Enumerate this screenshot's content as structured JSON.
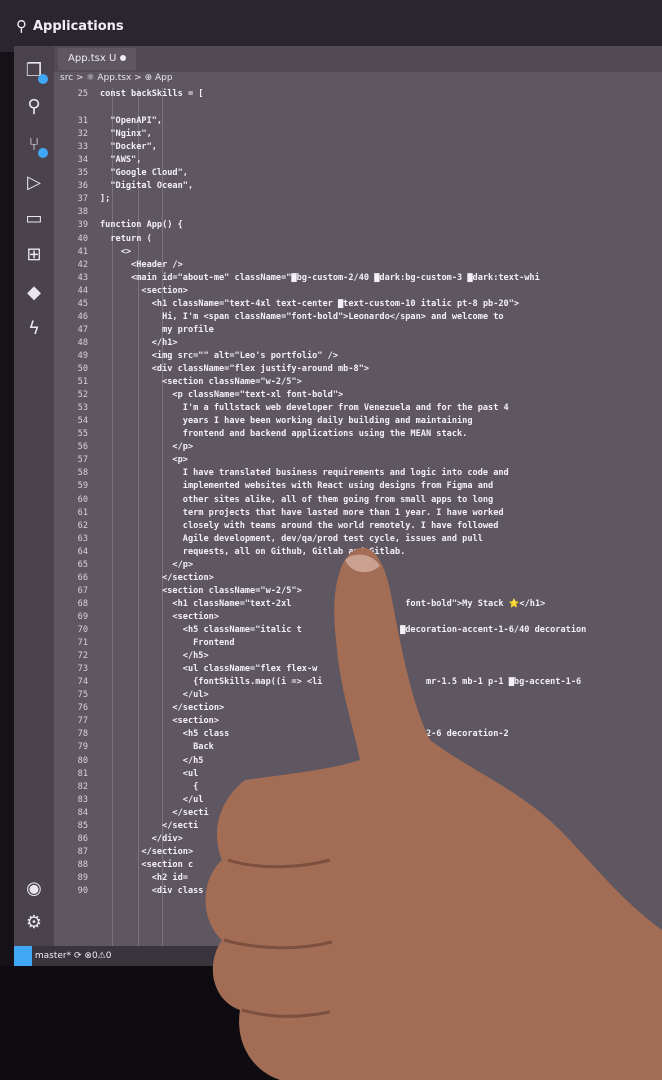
{
  "topbar": {
    "title": "Applications",
    "search_icon": "search-icon"
  },
  "tab": {
    "label": "App.tsx U"
  },
  "breadcrumb": {
    "text": "src > ⚛ App.tsx > ⊕ App"
  },
  "status": {
    "branch": "master*",
    "sync": "⟳",
    "problems": "⊗0⚠0"
  },
  "code": [
    {
      "n": "25",
      "t": "const backSkills = ["
    },
    {
      "n": "31",
      "t": "  \"OpenAPI\","
    },
    {
      "n": "32",
      "t": "  \"Nginx\","
    },
    {
      "n": "33",
      "t": "  \"Docker\","
    },
    {
      "n": "34",
      "t": "  \"AWS\","
    },
    {
      "n": "35",
      "t": "  \"Google Cloud\","
    },
    {
      "n": "36",
      "t": "  \"Digital Ocean\","
    },
    {
      "n": "37",
      "t": "];"
    },
    {
      "n": "38",
      "t": ""
    },
    {
      "n": "39",
      "t": "function App() {"
    },
    {
      "n": "40",
      "t": "  return ("
    },
    {
      "n": "41",
      "t": "    <>"
    },
    {
      "n": "42",
      "t": "      <Header />"
    },
    {
      "n": "43",
      "t": "      <main id=\"about-me\" className=\"▇bg-custom-2/40 ▇dark:bg-custom-3 ▇dark:text-whi"
    },
    {
      "n": "44",
      "t": "        <section>"
    },
    {
      "n": "45",
      "t": "          <h1 className=\"text-4xl text-center ▇text-custom-10 italic pt-8 pb-20\">"
    },
    {
      "n": "46",
      "t": "            Hi, I'm <span className=\"font-bold\">Leonardo</span> and welcome to"
    },
    {
      "n": "47",
      "t": "            my profile"
    },
    {
      "n": "48",
      "t": "          </h1>"
    },
    {
      "n": "49",
      "t": "          <img src=\"\" alt=\"Leo's portfolio\" />"
    },
    {
      "n": "50",
      "t": "          <div className=\"flex justify-around mb-8\">"
    },
    {
      "n": "51",
      "t": "            <section className=\"w-2/5\">"
    },
    {
      "n": "52",
      "t": "              <p className=\"text-xl font-bold\">"
    },
    {
      "n": "53",
      "t": "                I'm a fullstack web developer from Venezuela and for the past 4"
    },
    {
      "n": "54",
      "t": "                years I have been working daily building and maintaining"
    },
    {
      "n": "55",
      "t": "                frontend and backend applications using the MEAN stack."
    },
    {
      "n": "56",
      "t": "              </p>"
    },
    {
      "n": "57",
      "t": "              <p>"
    },
    {
      "n": "58",
      "t": "                I have translated business requirements and logic into code and"
    },
    {
      "n": "59",
      "t": "                implemented websites with React using designs from Figma and"
    },
    {
      "n": "60",
      "t": "                other sites alike, all of them going from small apps to long"
    },
    {
      "n": "61",
      "t": "                term projects that have lasted more than 1 year. I have worked"
    },
    {
      "n": "62",
      "t": "                closely with teams around the world remotely. I have followed"
    },
    {
      "n": "63",
      "t": "                Agile development, dev/qa/prod test cycle, issues and pull"
    },
    {
      "n": "64",
      "t": "                requests, all on Github, Gitlab and Gitlab."
    },
    {
      "n": "65",
      "t": "              </p>"
    },
    {
      "n": "66",
      "t": "            </section>"
    },
    {
      "n": "67",
      "t": "            <section className=\"w-2/5\">"
    },
    {
      "n": "68",
      "t": "              <h1 className=\"text-2xl                      font-bold\">My Stack ⭐</h1>"
    },
    {
      "n": "69",
      "t": "              <section>"
    },
    {
      "n": "70",
      "t": "                <h5 className=\"italic t                   ▇decoration-accent-1-6/40 decoration"
    },
    {
      "n": "71",
      "t": "                  Frontend"
    },
    {
      "n": "72",
      "t": "                </h5>"
    },
    {
      "n": "73",
      "t": "                <ul className=\"flex flex-w"
    },
    {
      "n": "74",
      "t": "                  {fontSkills.map((i => <li                    mr-1.5 mb-1 p-1 ▇bg-accent-1-6"
    },
    {
      "n": "75",
      "t": "                </ul>"
    },
    {
      "n": "76",
      "t": "              </section>"
    },
    {
      "n": "77",
      "t": "              <section>"
    },
    {
      "n": "78",
      "t": "                <h5 class                              -accent-2-6 decoration-2"
    },
    {
      "n": "79",
      "t": "                  Back"
    },
    {
      "n": "80",
      "t": "                </h5"
    },
    {
      "n": "81",
      "t": "                <ul"
    },
    {
      "n": "82",
      "t": "                  {"
    },
    {
      "n": "83",
      "t": "                </ul"
    },
    {
      "n": "84",
      "t": "              </secti                                  1 ▇bg-accent-2-6"
    },
    {
      "n": "85",
      "t": "            </secti"
    },
    {
      "n": "86",
      "t": "          </div>"
    },
    {
      "n": "87",
      "t": "        </section>"
    },
    {
      "n": "88",
      "t": "        <section c"
    },
    {
      "n": "89",
      "t": "          <h2 id="
    },
    {
      "n": "90",
      "t": "          <div class"
    }
  ],
  "colors": {
    "accent": "#3fa7f5",
    "editor_bg": "#5e5661",
    "text": "#f4f0f6"
  }
}
